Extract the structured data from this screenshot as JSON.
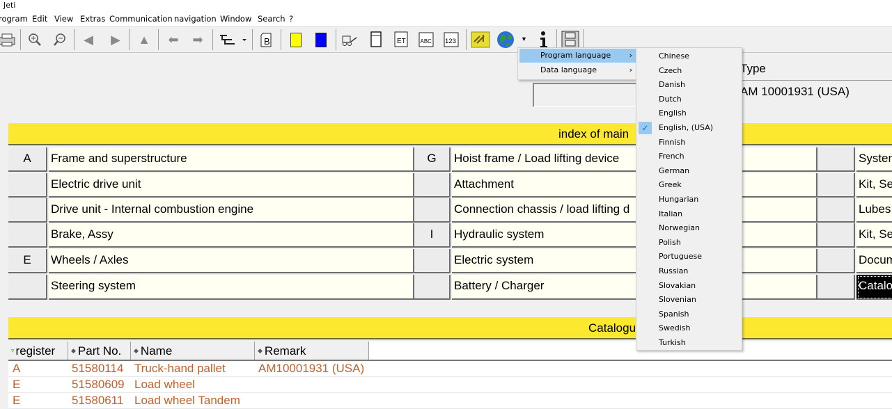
{
  "window": {
    "title": "Jeti"
  },
  "menubar": [
    "rogram",
    "Edit",
    "View",
    "Extras",
    "Communication",
    "navigation",
    "Window",
    "Search",
    "?"
  ],
  "toolbar": {
    "icons": [
      "printer-icon",
      "zoom-in-icon",
      "zoom-out-icon",
      "back-triangle-icon",
      "forward-triangle-icon",
      "up-triangle-icon",
      "arrow-left-icon",
      "arrow-right-icon",
      "tree-view-icon",
      "b-document-icon",
      "yellow-color-icon",
      "blue-color-icon",
      "forklift-icon",
      "cabinet-icon",
      "et-icon",
      "abc-icon",
      "123-icon",
      "forklift-yellow-icon",
      "globe-icon",
      "info-icon",
      "archive-icon"
    ],
    "et_label": "ET",
    "abc_label": "ABC",
    "n123_label": "123",
    "b_label": "B",
    "info_label": "i",
    "colors": {
      "yellow": "#ffff00",
      "blue": "#0000ff"
    }
  },
  "header": {
    "type_label": "Type",
    "type_value": "AM 10001931 (USA)"
  },
  "context_menu": {
    "items": [
      {
        "label": "Program language",
        "arrow": "›",
        "highlighted": true
      },
      {
        "label": "Data language",
        "arrow": "›",
        "highlighted": false
      }
    ]
  },
  "language_submenu": {
    "selected": "English, (USA)",
    "check": "✓",
    "items": [
      "Chinese",
      "Czech",
      "Danish",
      "Dutch",
      "English",
      "English, (USA)",
      "Finnish",
      "French",
      "German",
      "Greek",
      "Hungarian",
      "Italian",
      "Norwegian",
      "Polish",
      "Portuguese",
      "Russian",
      "Slovakian",
      "Slovenian",
      "Spanish",
      "Swedish",
      "Turkish"
    ]
  },
  "index": {
    "title": "index of main",
    "col1": [
      {
        "letter": "A",
        "label": "Frame and superstructure"
      },
      {
        "letter": "",
        "label": "Electric drive unit"
      },
      {
        "letter": "",
        "label": "Drive unit - Internal combustion engine"
      },
      {
        "letter": "",
        "label": "Brake, Assy"
      },
      {
        "letter": "E",
        "label": "Wheels / Axles"
      },
      {
        "letter": "",
        "label": "Steering system"
      }
    ],
    "col2": [
      {
        "letter": "G",
        "label": "Hoist frame / Load lifting device"
      },
      {
        "letter": "",
        "label": "Attachment"
      },
      {
        "letter": "",
        "label": "Connection chassis / load lifting d"
      },
      {
        "letter": "I",
        "label": "Hydraulic system"
      },
      {
        "letter": "",
        "label": "Electric system"
      },
      {
        "letter": "",
        "label": "Battery / Charger"
      }
    ],
    "col3": [
      {
        "letter": "",
        "label": "Systen"
      },
      {
        "letter": "",
        "label": "Kit, Se"
      },
      {
        "letter": "",
        "label": "Lubes"
      },
      {
        "letter": "",
        "label": "Kit, Se"
      },
      {
        "letter": "",
        "label": "Docum"
      },
      {
        "letter": "",
        "label": "Catalo",
        "selected": true
      }
    ]
  },
  "catalogue": {
    "title": "Catalogu",
    "columns": [
      {
        "label": "register",
        "marker": "▿"
      },
      {
        "label": "Part No.",
        "marker": "◆"
      },
      {
        "label": "Name",
        "marker": "◆"
      },
      {
        "label": "Remark",
        "marker": "◆"
      }
    ],
    "rows": [
      {
        "register": "A",
        "part_no": "51580114",
        "name": "Truck-hand pallet",
        "remark": "AM10001931 (USA)"
      },
      {
        "register": "E",
        "part_no": "51580609",
        "name": "Load wheel",
        "remark": ""
      },
      {
        "register": "E",
        "part_no": "51580611",
        "name": "Load wheel Tandem",
        "remark": ""
      }
    ]
  }
}
